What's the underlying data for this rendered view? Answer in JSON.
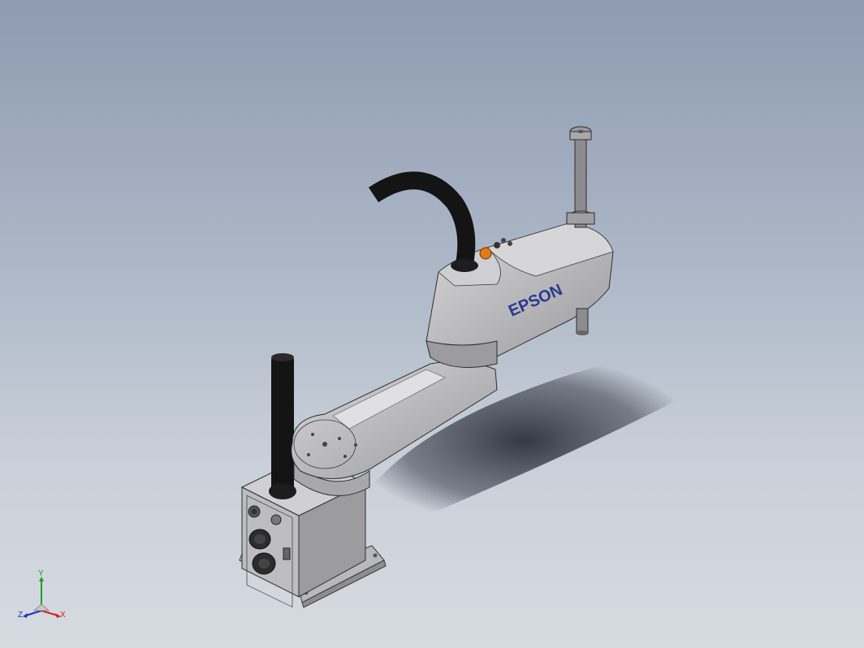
{
  "viewport": {
    "background_top": "#8e9bb1",
    "background_bottom": "#d6dbe1"
  },
  "model": {
    "brand_label": "EPSON",
    "brand_color": "#2a3a8f",
    "body_color": "#c4c4c6",
    "cable_color": "#111111",
    "button_color": "#e07a1a"
  },
  "triad": {
    "x_label": "X",
    "y_label": "Y",
    "z_label": "Z",
    "x_color": "#d42020",
    "y_color": "#20a020",
    "z_color": "#2030c0"
  }
}
